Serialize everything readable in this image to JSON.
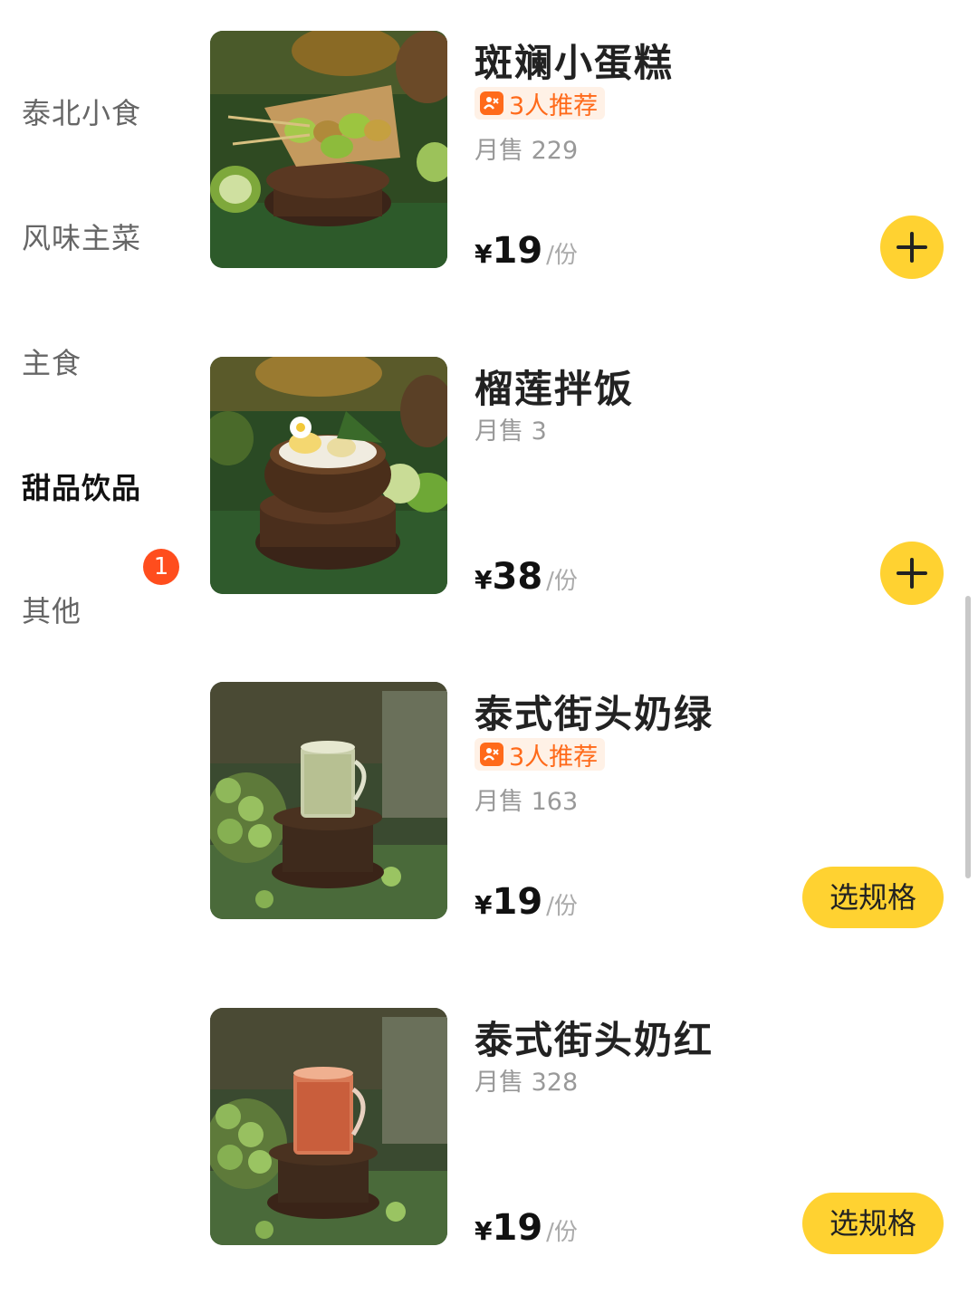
{
  "sidebar": {
    "categories": [
      {
        "label": "泰北小食"
      },
      {
        "label": "风味主菜"
      },
      {
        "label": "主食"
      },
      {
        "label": "甜品饮品"
      },
      {
        "label": "其他"
      }
    ],
    "active_index": 3,
    "badge_count": "1"
  },
  "products": [
    {
      "name": "斑斓小蛋糕",
      "recommend": "3人推荐",
      "sales": "月售 229",
      "currency": "¥",
      "price": "19",
      "unit": "/份",
      "action": "add",
      "image": "pandan-cake-photo"
    },
    {
      "name": "榴莲拌饭",
      "sales": "月售 3",
      "currency": "¥",
      "price": "38",
      "unit": "/份",
      "action": "add",
      "image": "durian-rice-photo"
    },
    {
      "name": "泰式街头奶绿",
      "recommend": "3人推荐",
      "sales": "月售 163",
      "currency": "¥",
      "price": "19",
      "unit": "/份",
      "action": "spec",
      "action_label": "选规格",
      "image": "thai-green-milk-tea-photo"
    },
    {
      "name": "泰式街头奶红",
      "sales": "月售 328",
      "currency": "¥",
      "price": "19",
      "unit": "/份",
      "action": "spec",
      "action_label": "选规格",
      "image": "thai-red-milk-tea-photo"
    }
  ],
  "colors": {
    "accent_yellow": "#ffd231",
    "badge_red": "#ff4d1d",
    "recommend_orange": "#ff6a1a"
  }
}
